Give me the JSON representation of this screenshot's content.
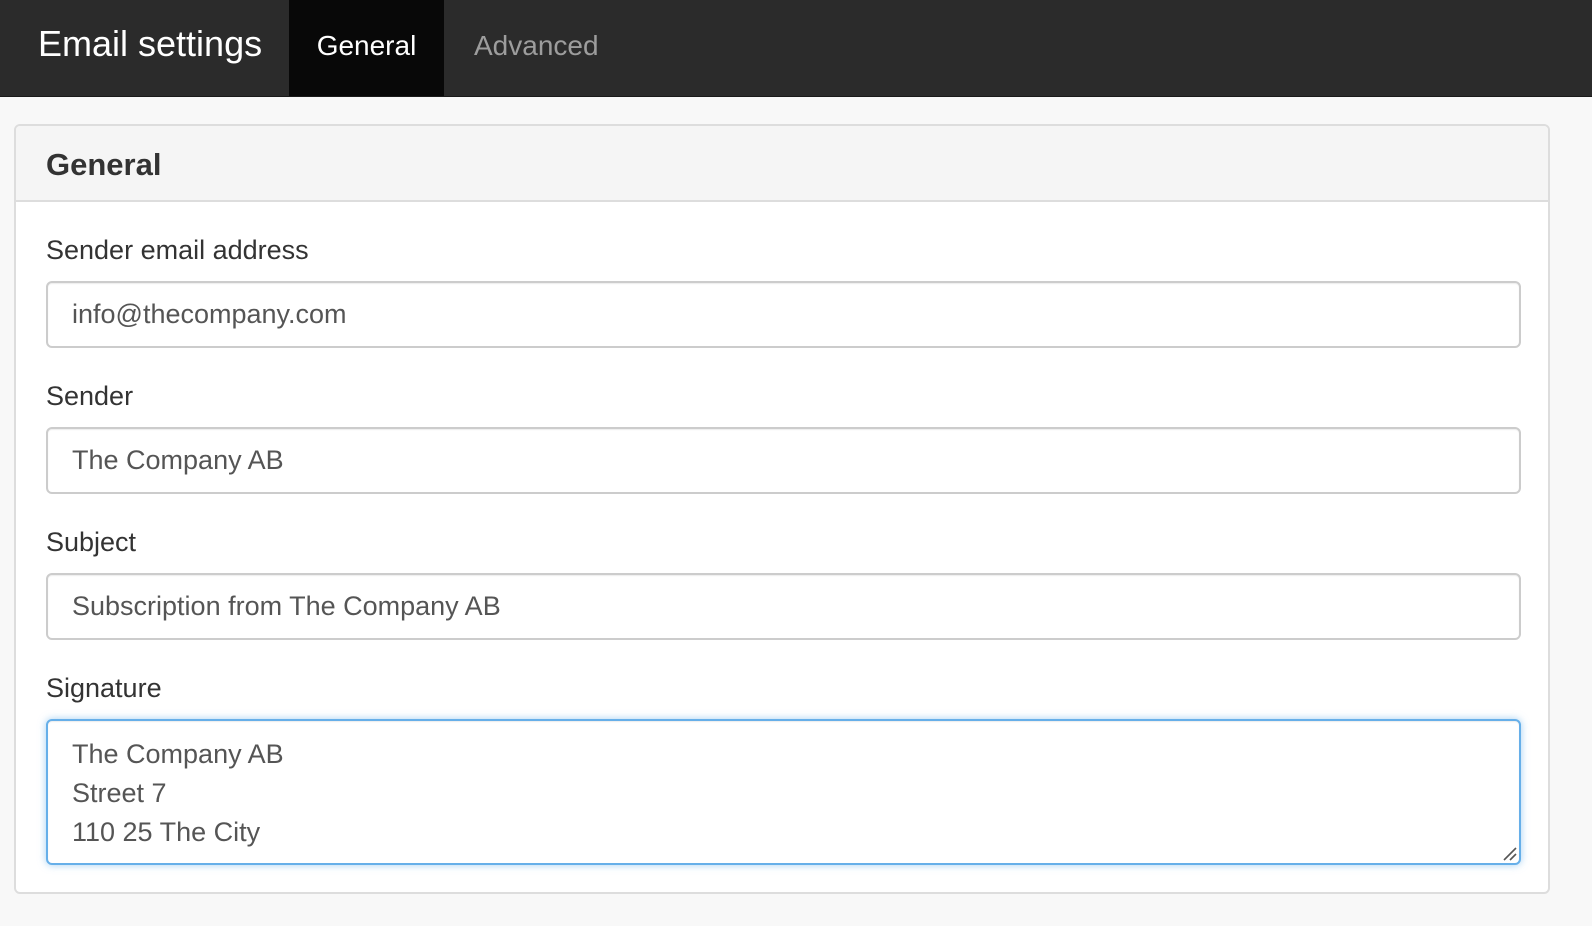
{
  "navbar": {
    "brand": "Email settings",
    "tabs": [
      {
        "label": "General",
        "active": true
      },
      {
        "label": "Advanced",
        "active": false
      }
    ]
  },
  "panel": {
    "title": "General",
    "fields": {
      "sender_email": {
        "label": "Sender email address",
        "value": "info@thecompany.com"
      },
      "sender": {
        "label": "Sender",
        "value": "The Company AB"
      },
      "subject": {
        "label": "Subject",
        "value": "Subscription from The Company AB"
      },
      "signature": {
        "label": "Signature",
        "lines": [
          "The Company AB",
          "Street 7",
          "110 25 The City"
        ]
      }
    }
  },
  "colors": {
    "navbar_bg": "#2b2b2b",
    "active_tab_bg": "#080808",
    "inactive_tab_text": "#9d9d9d",
    "focus_border": "#66afe9"
  },
  "icons": {
    "resize_handle": "resize-handle-icon"
  }
}
